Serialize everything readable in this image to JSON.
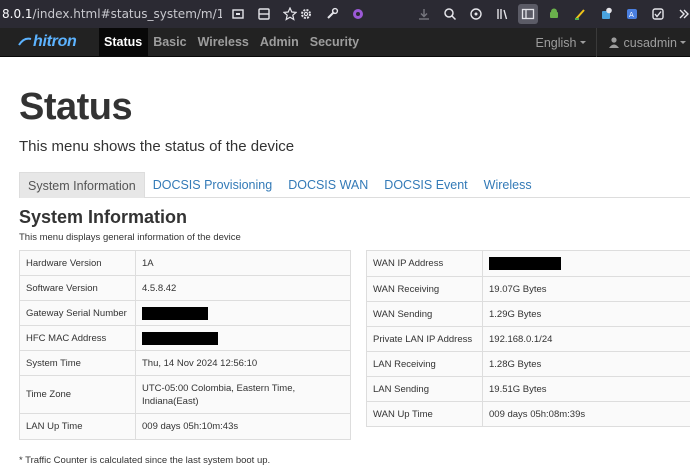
{
  "browser": {
    "url_prefix": "8.0.1",
    "url_rest": "/index.html#status_system/m/1/s/1"
  },
  "nav": {
    "logo_text": "hitron",
    "items": [
      {
        "label": "Status",
        "active": true
      },
      {
        "label": "Basic",
        "active": false
      },
      {
        "label": "Wireless",
        "active": false
      },
      {
        "label": "Admin",
        "active": false
      },
      {
        "label": "Security",
        "active": false
      }
    ],
    "language": "English",
    "user": "cusadmin"
  },
  "page": {
    "title": "Status",
    "subtitle": "This menu shows the status of the device"
  },
  "tabs": [
    {
      "label": "System Information",
      "active": true
    },
    {
      "label": "DOCSIS Provisioning",
      "active": false
    },
    {
      "label": "DOCSIS WAN",
      "active": false
    },
    {
      "label": "DOCSIS Event",
      "active": false
    },
    {
      "label": "Wireless",
      "active": false
    }
  ],
  "section": {
    "title": "System Information",
    "subtitle": "This menu displays general information of the device"
  },
  "left_rows": [
    {
      "label": "Hardware Version",
      "value": "1A"
    },
    {
      "label": "Software Version",
      "value": "4.5.8.42"
    },
    {
      "label": "Gateway Serial Number",
      "value": "",
      "redacted": true
    },
    {
      "label": "HFC MAC Address",
      "value": "",
      "redacted": true
    },
    {
      "label": "System Time",
      "value": "Thu, 14 Nov 2024 12:56:10"
    },
    {
      "label": "Time Zone",
      "value": "UTC-05:00 Colombia, Eastern Time, Indiana(East)"
    },
    {
      "label": "LAN Up Time",
      "value": "009 days 05h:10m:43s"
    }
  ],
  "right_rows": [
    {
      "label": "WAN IP Address",
      "value": "",
      "redacted": true
    },
    {
      "label": "WAN Receiving",
      "value": "19.07G Bytes"
    },
    {
      "label": "WAN Sending",
      "value": "1.29G Bytes"
    },
    {
      "label": "Private LAN IP Address",
      "value": "192.168.0.1/24"
    },
    {
      "label": "LAN Receiving",
      "value": "1.28G Bytes"
    },
    {
      "label": "LAN Sending",
      "value": "19.51G Bytes"
    },
    {
      "label": "WAN Up Time",
      "value": "009 days 05h:08m:39s"
    }
  ],
  "footnote": "* Traffic Counter is calculated since the last system boot up."
}
